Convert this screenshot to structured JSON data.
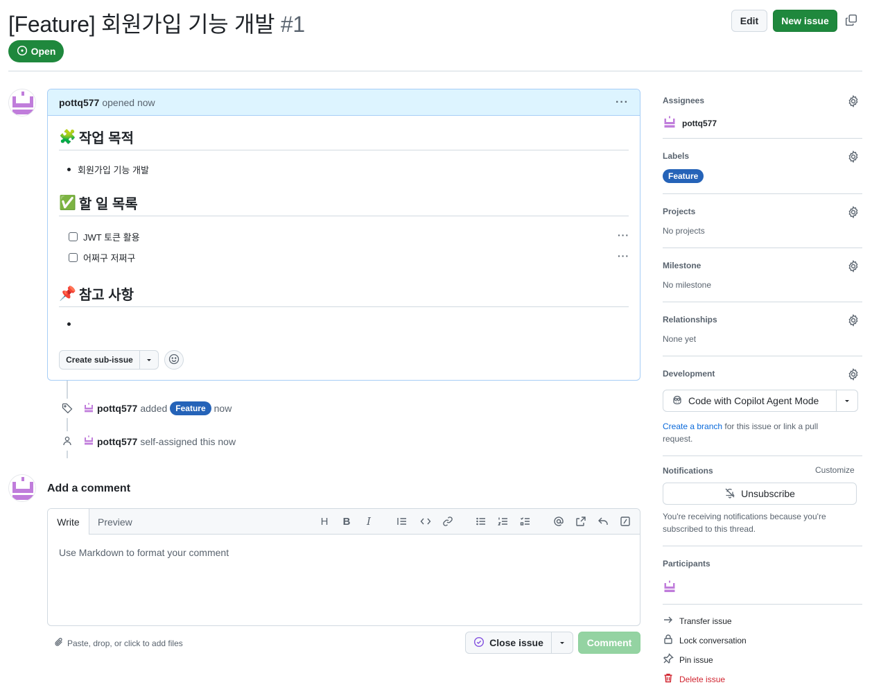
{
  "header": {
    "title": "[Feature] 회원가입 기능 개발",
    "number": "#1",
    "edit_label": "Edit",
    "new_issue_label": "New issue",
    "state_label": "Open"
  },
  "issue": {
    "author": "pottq577",
    "opened_text": "opened now",
    "sections": {
      "purpose_emoji": "🧩",
      "purpose_title": "작업 목적",
      "purpose_item": "회원가입 기능 개발",
      "todo_emoji": "✅",
      "todo_title": "할 일 목록",
      "tasks": [
        "JWT 토큰 활용",
        "어쩌구 저쩌구"
      ],
      "ref_emoji": "📌",
      "ref_title": "참고 사항"
    },
    "create_subissue_label": "Create sub-issue"
  },
  "timeline": {
    "event1_user": "pottq577",
    "event1_action": "added",
    "event1_label": "Feature",
    "event1_time": "now",
    "event2_user": "pottq577",
    "event2_action": "self-assigned this now"
  },
  "composer": {
    "heading": "Add a comment",
    "tab_write": "Write",
    "tab_preview": "Preview",
    "placeholder": "Use Markdown to format your comment",
    "attach_text": "Paste, drop, or click to add files",
    "close_issue_label": "Close issue",
    "comment_label": "Comment"
  },
  "sidebar": {
    "assignees_title": "Assignees",
    "assignee_name": "pottq577",
    "labels_title": "Labels",
    "label_name": "Feature",
    "projects_title": "Projects",
    "projects_value": "No projects",
    "milestone_title": "Milestone",
    "milestone_value": "No milestone",
    "relationships_title": "Relationships",
    "relationships_value": "None yet",
    "development_title": "Development",
    "copilot_label": "Code with Copilot Agent Mode",
    "dev_link": "Create a branch",
    "dev_text": "for this issue or link a pull request.",
    "notifications_title": "Notifications",
    "customize_label": "Customize",
    "unsubscribe_label": "Unsubscribe",
    "notif_text": "You're receiving notifications because you're subscribed to this thread.",
    "participants_title": "Participants",
    "actions": {
      "transfer": "Transfer issue",
      "lock": "Lock conversation",
      "pin": "Pin issue",
      "delete": "Delete issue"
    }
  },
  "colors": {
    "primary_green": "#1f883d",
    "label_blue": "#2563b8",
    "header_blue": "#ddf4ff",
    "danger_red": "#d1242f",
    "link_blue": "#0969da",
    "avatar_purple": "#c07ddb"
  }
}
